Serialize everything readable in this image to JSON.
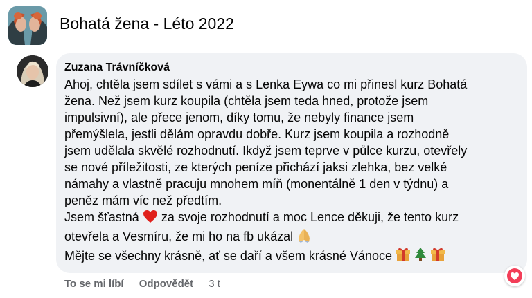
{
  "group": {
    "title": "Bohatá žena - Léto 2022"
  },
  "comment": {
    "author": "Zuzana Trávníčková",
    "lines": [
      "Ahoj, chtěla jsem sdílet s vámi a s Lenka Eywa co mi přinesl kurz Bohatá",
      "žena. Než jsem kurz koupila (chtěla jsem teda hned, protože jsem",
      "impulsivní), ale přece jenom, díky tomu, že nebyly finance jsem",
      "přemýšlela, jestli dělám opravdu dobře. Kurz jsem koupila a rozhodně",
      "jsem udělala skvělé rozhodnutí. Ikdyž jsem teprve v půlce kurzu, otevřely",
      "se nové příležitosti, ze kterých peníze přichází jaksi zlehka, bez velké",
      "námahy a vlastně pracuju mnohem míň (monentálně 1 den v týdnu) a",
      "peněz mám víc než předtím."
    ],
    "line9_before": "Jsem šťastná",
    "line9_after": "za svoje rozhodnutí a moc Lence děkuji, že tento kurz",
    "line10": "otevřela a Vesmíru, že mi ho na fb ukázal",
    "line11": "Mějte se všechny krásně, ať se daří a všem krásné Vánoce",
    "emoji": {
      "heart": "red-heart",
      "pray": "folded-hands",
      "gift": "gift",
      "tree": "christmas-tree"
    }
  },
  "actions": {
    "like": "To se mi líbí",
    "reply": "Odpovědět",
    "time": "3 t"
  },
  "reaction_icon": "heart-reaction",
  "colors": {
    "bubble": "#f0f2f5",
    "meta_text": "#65676b",
    "heart": "#f33e58"
  }
}
